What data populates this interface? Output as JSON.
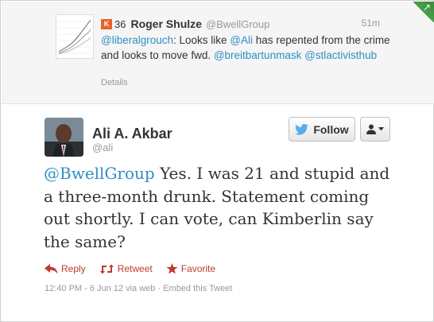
{
  "parent_tweet": {
    "klout_badge": "K",
    "klout_score": "36",
    "name": "Roger Shulze",
    "handle": "@BwellGroup",
    "time": "51m",
    "text_parts": [
      {
        "text": "@liberalgrouch",
        "link": true
      },
      {
        "text": ": Looks like ",
        "link": false
      },
      {
        "text": "@Ali",
        "link": true
      },
      {
        "text": " has repented from the crime and looks to move fwd. ",
        "link": false
      },
      {
        "text": "@breitbartunmask",
        "link": true
      },
      {
        "text": " ",
        "link": false
      },
      {
        "text": "@stlactivisthub",
        "link": true
      }
    ],
    "details_label": "Details"
  },
  "main_tweet": {
    "name": "Ali A. Akbar",
    "handle": "@ali",
    "follow_label": "Follow",
    "reply_to": "@BwellGroup",
    "text": " Yes. I was 21 and stupid and a three-month drunk. Statement coming out shortly. I can vote, can Kimberlin say the same?",
    "actions": {
      "reply": "Reply",
      "retweet": "Retweet",
      "favorite": "Favorite"
    },
    "meta": "12:40 PM - 6 Jun 12 via web · Embed this Tweet"
  },
  "colors": {
    "link": "#2f8fc3",
    "action": "#c0392b",
    "twitter_bird": "#55acee",
    "klout": "#e8622b"
  }
}
